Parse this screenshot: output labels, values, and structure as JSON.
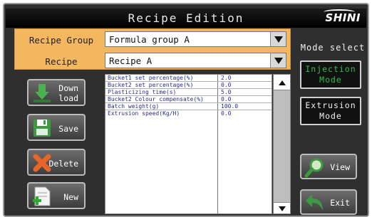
{
  "header": {
    "title": "Recipe Edition",
    "logo": "SHINI"
  },
  "recipe_group": {
    "label": "Recipe Group",
    "value": "Formula group A"
  },
  "recipe": {
    "label": "Recipe",
    "value": "Recipe A"
  },
  "mode_select": {
    "label": "Mode select",
    "injection": {
      "line1": "Injection",
      "line2": "Mode",
      "color": "#2fbf4f"
    },
    "extrusion": {
      "line1": "Extrusion",
      "line2": "Mode"
    }
  },
  "left_buttons": {
    "download": {
      "line1": "Down",
      "line2": "load",
      "icon": "download-arrow-icon"
    },
    "save": {
      "label": "Save",
      "icon": "floppy-disk-icon"
    },
    "delete": {
      "label": "Delete",
      "icon": "red-x-icon"
    },
    "new": {
      "label": "New",
      "icon": "new-document-plus-icon"
    }
  },
  "right_buttons": {
    "view": {
      "label": "View",
      "icon": "magnifier-icon"
    },
    "exit": {
      "label": "Exit",
      "icon": "return-arrow-icon"
    }
  },
  "parameters": [
    {
      "name": "Bucket1 set percentage(%)",
      "value": "2.0"
    },
    {
      "name": "Bucket2 set percentage(%)",
      "value": "0.0"
    },
    {
      "name": "Plasticizing time(s)",
      "value": "5.0"
    },
    {
      "name": "Bucket2 Colour compensate(%)",
      "value": "0.0"
    },
    {
      "name": "Batch weight(g)",
      "value": "100.0"
    },
    {
      "name": "Extrusion speed(Kg/H)",
      "value": "0.0"
    }
  ]
}
